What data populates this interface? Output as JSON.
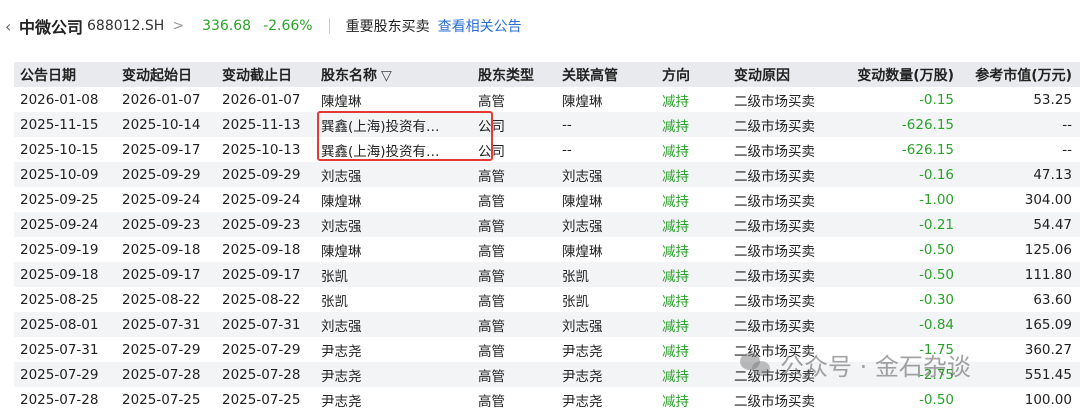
{
  "header": {
    "back_icon": "chevron-left-icon",
    "stock_name": "中微公司",
    "stock_code": "688012.SH",
    "chevron": ">",
    "price": "336.68",
    "change_pct": "-2.66%",
    "section_title": "重要股东买卖",
    "announcement_link": "查看相关公告"
  },
  "colors": {
    "down": "#2aa22a",
    "link": "#2a6fd6",
    "highlight": "#e53935",
    "header_bg": "#e9eaee"
  },
  "table": {
    "columns": [
      "公告日期",
      "变动起始日",
      "变动截止日",
      "股东名称",
      "股东类型",
      "关联高管",
      "方向",
      "变动原因",
      "变动数量(万股)",
      "参考市值(万元)"
    ],
    "filter_icon": "filter-icon",
    "rows": [
      [
        "2026-01-08",
        "2026-01-07",
        "2026-01-07",
        "陳煌琳",
        "高管",
        "陳煌琳",
        "减持",
        "二级市场买卖",
        "-0.15",
        "53.25"
      ],
      [
        "2025-11-15",
        "2025-10-14",
        "2025-11-13",
        "巽鑫(上海)投资有…",
        "公司",
        "--",
        "减持",
        "二级市场买卖",
        "-626.15",
        "--"
      ],
      [
        "2025-10-15",
        "2025-09-17",
        "2025-10-13",
        "巽鑫(上海)投资有…",
        "公司",
        "--",
        "减持",
        "二级市场买卖",
        "-626.15",
        "--"
      ],
      [
        "2025-10-09",
        "2025-09-29",
        "2025-09-29",
        "刘志强",
        "高管",
        "刘志强",
        "减持",
        "二级市场买卖",
        "-0.16",
        "47.13"
      ],
      [
        "2025-09-25",
        "2025-09-24",
        "2025-09-24",
        "陳煌琳",
        "高管",
        "陳煌琳",
        "减持",
        "二级市场买卖",
        "-1.00",
        "304.00"
      ],
      [
        "2025-09-24",
        "2025-09-23",
        "2025-09-23",
        "刘志强",
        "高管",
        "刘志强",
        "减持",
        "二级市场买卖",
        "-0.21",
        "54.47"
      ],
      [
        "2025-09-19",
        "2025-09-18",
        "2025-09-18",
        "陳煌琳",
        "高管",
        "陳煌琳",
        "减持",
        "二级市场买卖",
        "-0.50",
        "125.06"
      ],
      [
        "2025-09-18",
        "2025-09-17",
        "2025-09-17",
        "张凯",
        "高管",
        "张凯",
        "减持",
        "二级市场买卖",
        "-0.50",
        "111.80"
      ],
      [
        "2025-08-25",
        "2025-08-22",
        "2025-08-22",
        "张凯",
        "高管",
        "张凯",
        "减持",
        "二级市场买卖",
        "-0.30",
        "63.60"
      ],
      [
        "2025-08-01",
        "2025-07-31",
        "2025-07-31",
        "刘志强",
        "高管",
        "刘志强",
        "减持",
        "二级市场买卖",
        "-0.84",
        "165.09"
      ],
      [
        "2025-07-31",
        "2025-07-29",
        "2025-07-29",
        "尹志尧",
        "高管",
        "尹志尧",
        "减持",
        "二级市场买卖",
        "-1.75",
        "360.27"
      ],
      [
        "2025-07-29",
        "2025-07-28",
        "2025-07-28",
        "尹志尧",
        "高管",
        "尹志尧",
        "减持",
        "二级市场买卖",
        "-2.75",
        "551.45"
      ],
      [
        "2025-07-28",
        "2025-07-25",
        "2025-07-25",
        "尹志尧",
        "高管",
        "尹志尧",
        "减持",
        "二级市场买卖",
        "-0.50",
        "100.00"
      ]
    ]
  },
  "watermark": {
    "icon": "wechat-icon",
    "text": "公众号 · 金石杂谈"
  }
}
